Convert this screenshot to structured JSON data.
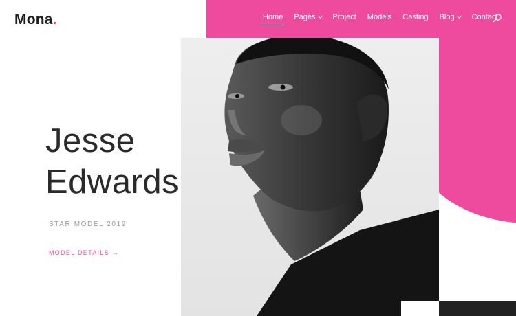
{
  "brand": {
    "name": "Mona",
    "dot": ".",
    "accent": "#ef4b9e"
  },
  "nav": {
    "items": [
      {
        "label": "Home",
        "active": true,
        "dropdown": false
      },
      {
        "label": "Pages",
        "active": false,
        "dropdown": true
      },
      {
        "label": "Project",
        "active": false,
        "dropdown": false
      },
      {
        "label": "Models",
        "active": false,
        "dropdown": false
      },
      {
        "label": "Casting",
        "active": false,
        "dropdown": false
      },
      {
        "label": "Blog",
        "active": false,
        "dropdown": true
      },
      {
        "label": "Contact",
        "active": false,
        "dropdown": false
      }
    ],
    "search_icon": "search-icon"
  },
  "hero": {
    "first_name": "Jesse",
    "last_name": "Edwards",
    "subtitle": "STAR MODEL 2019",
    "link_label": "MODEL DETAILS",
    "link_arrow": "→"
  },
  "colors": {
    "accent": "#ef4b9e",
    "text_dark": "#2a2a2a",
    "muted": "#999999",
    "footer_dark": "#222222"
  }
}
